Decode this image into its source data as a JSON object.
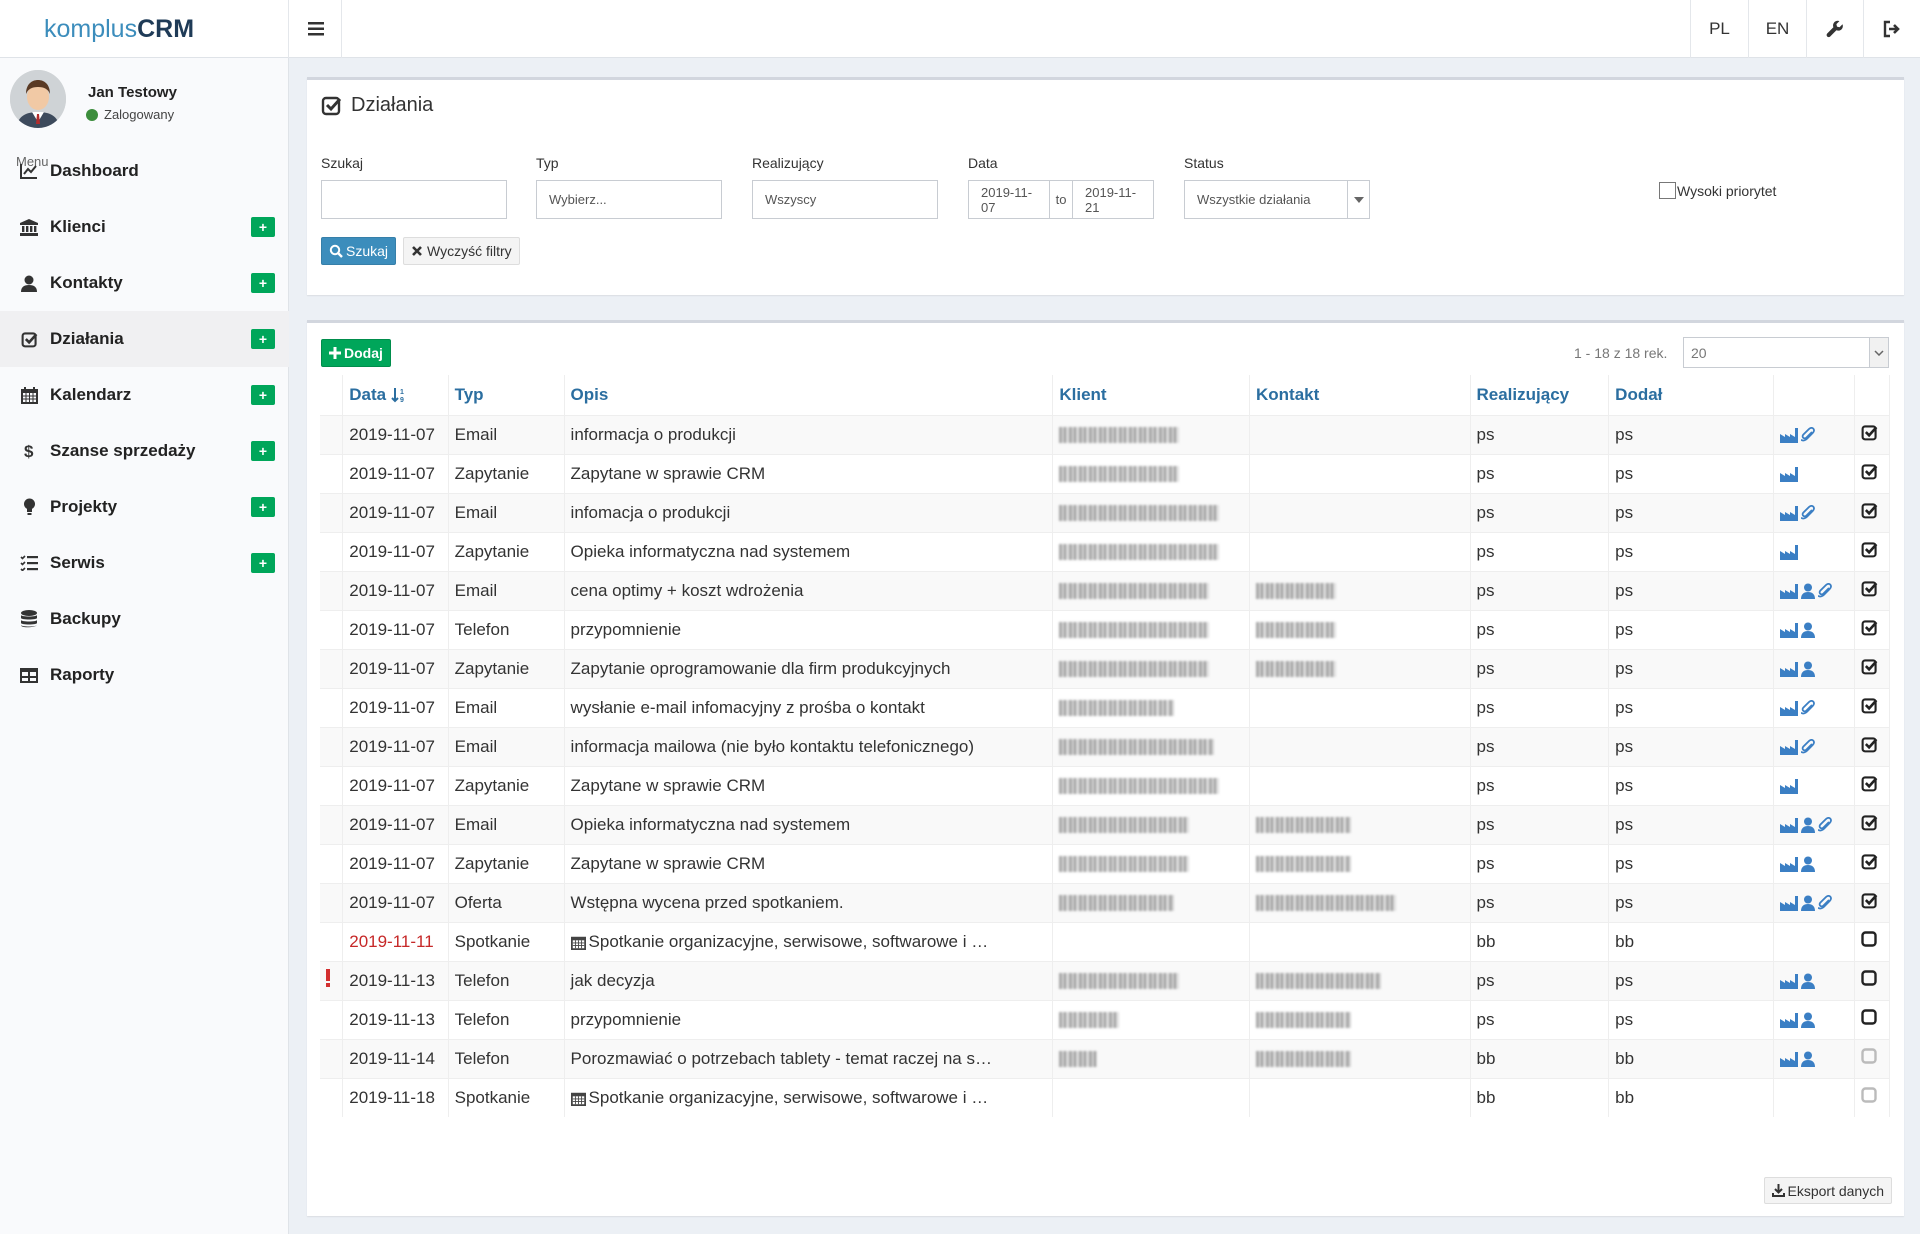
{
  "app": {
    "logo_part1": "komplus",
    "logo_part2": "CRM"
  },
  "topbar": {
    "lang_pl": "PL",
    "lang_en": "EN"
  },
  "user": {
    "name": "Jan Testowy",
    "status": "Zalogowany"
  },
  "sidebar": {
    "menu_header": "Menu",
    "items": [
      {
        "label": "Dashboard",
        "icon": "chart-line-icon",
        "plus": false
      },
      {
        "label": "Klienci",
        "icon": "bank-icon",
        "plus": true
      },
      {
        "label": "Kontakty",
        "icon": "user-icon",
        "plus": true
      },
      {
        "label": "Działania",
        "icon": "check-square-icon",
        "plus": true,
        "active": true
      },
      {
        "label": "Kalendarz",
        "icon": "calendar-icon",
        "plus": true
      },
      {
        "label": "Szanse sprzedaży",
        "icon": "dollar-icon",
        "plus": true
      },
      {
        "label": "Projekty",
        "icon": "lightbulb-icon",
        "plus": true
      },
      {
        "label": "Serwis",
        "icon": "tasks-icon",
        "plus": true
      },
      {
        "label": "Backupy",
        "icon": "database-icon",
        "plus": false
      },
      {
        "label": "Raporty",
        "icon": "table-icon",
        "plus": false
      }
    ],
    "plus_label": "+"
  },
  "filters": {
    "title": "Działania",
    "search_label": "Szukaj",
    "search_value": "",
    "type_label": "Typ",
    "type_placeholder": "Wybierz...",
    "exec_label": "Realizujący",
    "exec_value": "Wszyscy",
    "date_label": "Data",
    "date_from": "2019-11-07",
    "date_to_label": "to",
    "date_to": "2019-11-21",
    "status_label": "Status",
    "status_value": "Wszystkie działania",
    "priority_label": "Wysoki priorytet",
    "search_button": "Szukaj",
    "clear_button": "Wyczyść filtry"
  },
  "list": {
    "add_button": "Dodaj",
    "records_info": "1 - 18 z 18 rek.",
    "page_size": "20",
    "export_button": "Eksport danych",
    "columns": [
      "Data",
      "Typ",
      "Opis",
      "Klient",
      "Kontakt",
      "Realizujący",
      "Dodał"
    ],
    "rows": [
      {
        "date": "2019-11-07",
        "type": "Email",
        "desc": "informacja o produkcji",
        "client_w": 120,
        "contact_w": 0,
        "exec": "ps",
        "added": "ps",
        "icons": [
          "factory",
          "clip"
        ],
        "done": true,
        "prio": false,
        "late": false,
        "cal": false
      },
      {
        "date": "2019-11-07",
        "type": "Zapytanie",
        "desc": "Zapytane w sprawie CRM",
        "client_w": 120,
        "contact_w": 0,
        "exec": "ps",
        "added": "ps",
        "icons": [
          "factory"
        ],
        "done": true,
        "prio": false,
        "late": false,
        "cal": false
      },
      {
        "date": "2019-11-07",
        "type": "Email",
        "desc": "infomacja o produkcji",
        "client_w": 160,
        "contact_w": 0,
        "exec": "ps",
        "added": "ps",
        "icons": [
          "factory",
          "clip"
        ],
        "done": true,
        "prio": false,
        "late": false,
        "cal": false
      },
      {
        "date": "2019-11-07",
        "type": "Zapytanie",
        "desc": "Opieka informatyczna nad systemem",
        "client_w": 160,
        "contact_w": 0,
        "exec": "ps",
        "added": "ps",
        "icons": [
          "factory"
        ],
        "done": true,
        "prio": false,
        "late": false,
        "cal": false
      },
      {
        "date": "2019-11-07",
        "type": "Email",
        "desc": "cena optimy + koszt wdrożenia",
        "client_w": 150,
        "contact_w": 80,
        "exec": "ps",
        "added": "ps",
        "icons": [
          "factory",
          "user",
          "clip"
        ],
        "done": true,
        "prio": false,
        "late": false,
        "cal": false
      },
      {
        "date": "2019-11-07",
        "type": "Telefon",
        "desc": "przypomnienie",
        "client_w": 150,
        "contact_w": 80,
        "exec": "ps",
        "added": "ps",
        "icons": [
          "factory",
          "user"
        ],
        "done": true,
        "prio": false,
        "late": false,
        "cal": false
      },
      {
        "date": "2019-11-07",
        "type": "Zapytanie",
        "desc": "Zapytanie oprogramowanie dla firm produkcyjnych",
        "client_w": 150,
        "contact_w": 80,
        "exec": "ps",
        "added": "ps",
        "icons": [
          "factory",
          "user"
        ],
        "done": true,
        "prio": false,
        "late": false,
        "cal": false
      },
      {
        "date": "2019-11-07",
        "type": "Email",
        "desc": "wysłanie e-mail infomacyjny z prośba o kontakt",
        "client_w": 115,
        "contact_w": 0,
        "exec": "ps",
        "added": "ps",
        "icons": [
          "factory",
          "clip"
        ],
        "done": true,
        "prio": false,
        "late": false,
        "cal": false
      },
      {
        "date": "2019-11-07",
        "type": "Email",
        "desc": "informacja mailowa (nie było kontaktu telefonicznego)",
        "client_w": 155,
        "contact_w": 0,
        "exec": "ps",
        "added": "ps",
        "icons": [
          "factory",
          "clip"
        ],
        "done": true,
        "prio": false,
        "late": false,
        "cal": false
      },
      {
        "date": "2019-11-07",
        "type": "Zapytanie",
        "desc": "Zapytane w sprawie CRM",
        "client_w": 160,
        "contact_w": 0,
        "exec": "ps",
        "added": "ps",
        "icons": [
          "factory"
        ],
        "done": true,
        "prio": false,
        "late": false,
        "cal": false
      },
      {
        "date": "2019-11-07",
        "type": "Email",
        "desc": "Opieka informatyczna nad systemem",
        "client_w": 130,
        "contact_w": 95,
        "exec": "ps",
        "added": "ps",
        "icons": [
          "factory",
          "user",
          "clip"
        ],
        "done": true,
        "prio": false,
        "late": false,
        "cal": false
      },
      {
        "date": "2019-11-07",
        "type": "Zapytanie",
        "desc": "Zapytane w sprawie CRM",
        "client_w": 130,
        "contact_w": 95,
        "exec": "ps",
        "added": "ps",
        "icons": [
          "factory",
          "user"
        ],
        "done": true,
        "prio": false,
        "late": false,
        "cal": false
      },
      {
        "date": "2019-11-07",
        "type": "Oferta",
        "desc": "Wstępna wycena przed spotkaniem.",
        "client_w": 115,
        "contact_w": 140,
        "exec": "ps",
        "added": "ps",
        "icons": [
          "factory",
          "user",
          "clip"
        ],
        "done": true,
        "prio": false,
        "late": false,
        "cal": false
      },
      {
        "date": "2019-11-11",
        "type": "Spotkanie",
        "desc": "Spotkanie organizacyjne, serwisowe, softwarowe i …",
        "client_w": 0,
        "contact_w": 0,
        "exec": "bb",
        "added": "bb",
        "icons": [],
        "done": false,
        "prio": false,
        "late": true,
        "cal": true
      },
      {
        "date": "2019-11-13",
        "type": "Telefon",
        "desc": "jak decyzja",
        "client_w": 120,
        "contact_w": 125,
        "exec": "ps",
        "added": "ps",
        "icons": [
          "factory",
          "user"
        ],
        "done": false,
        "prio": true,
        "late": false,
        "cal": false
      },
      {
        "date": "2019-11-13",
        "type": "Telefon",
        "desc": "przypomnienie",
        "client_w": 60,
        "contact_w": 95,
        "exec": "ps",
        "added": "ps",
        "icons": [
          "factory",
          "user"
        ],
        "done": false,
        "prio": false,
        "late": false,
        "cal": false
      },
      {
        "date": "2019-11-14",
        "type": "Telefon",
        "desc": "Porozmawiać o potrzebach tablety - temat raczej na s…",
        "client_w": 38,
        "contact_w": 95,
        "exec": "bb",
        "added": "bb",
        "icons": [
          "factory",
          "user"
        ],
        "done": false,
        "prio": false,
        "late": false,
        "cal": false,
        "faded": true
      },
      {
        "date": "2019-11-18",
        "type": "Spotkanie",
        "desc": "Spotkanie organizacyjne, serwisowe, softwarowe i …",
        "client_w": 0,
        "contact_w": 0,
        "exec": "bb",
        "added": "bb",
        "icons": [],
        "done": false,
        "prio": false,
        "late": false,
        "cal": true,
        "faded": true
      }
    ]
  },
  "colors": {
    "accent": "#3c8dbc",
    "success": "#00a65a",
    "header_link": "#2b6ea0",
    "late": "#c62828",
    "icon_blue": "#3b7fc4"
  }
}
